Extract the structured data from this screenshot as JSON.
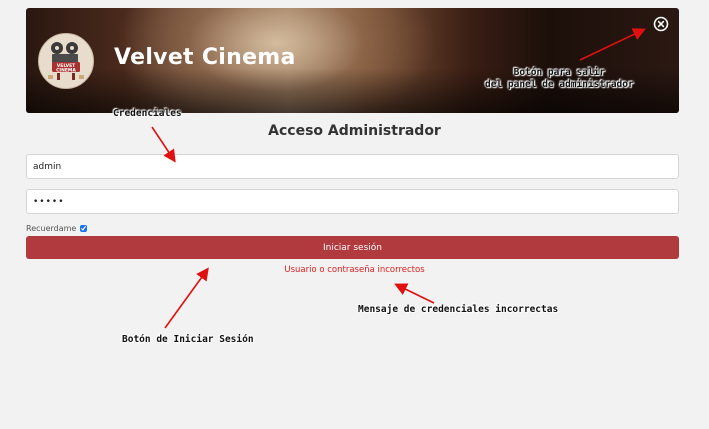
{
  "header": {
    "brand_title": "Velvet Cinema",
    "logo_text": "VELVET CINEMA",
    "close_icon": "close-circle-icon"
  },
  "login": {
    "title": "Acceso Administrador",
    "username_value": "admin",
    "password_value": "•••••",
    "remember_label": "Recuerdame",
    "remember_checked": true,
    "submit_label": "Iniciar sesión",
    "error_message": "Usuario o contraseña incorrectos"
  },
  "annotations": {
    "exit_line1": "Botón para salir",
    "exit_line2": "del panel de administrador",
    "credentials": "Credenciales",
    "error_msg": "Mensaje de credenciales incorrectas",
    "login_button": "Botón de Iniciar Sesión"
  },
  "colors": {
    "accent": "#b03a3e",
    "error": "#e02020",
    "arrow": "#e01010"
  }
}
